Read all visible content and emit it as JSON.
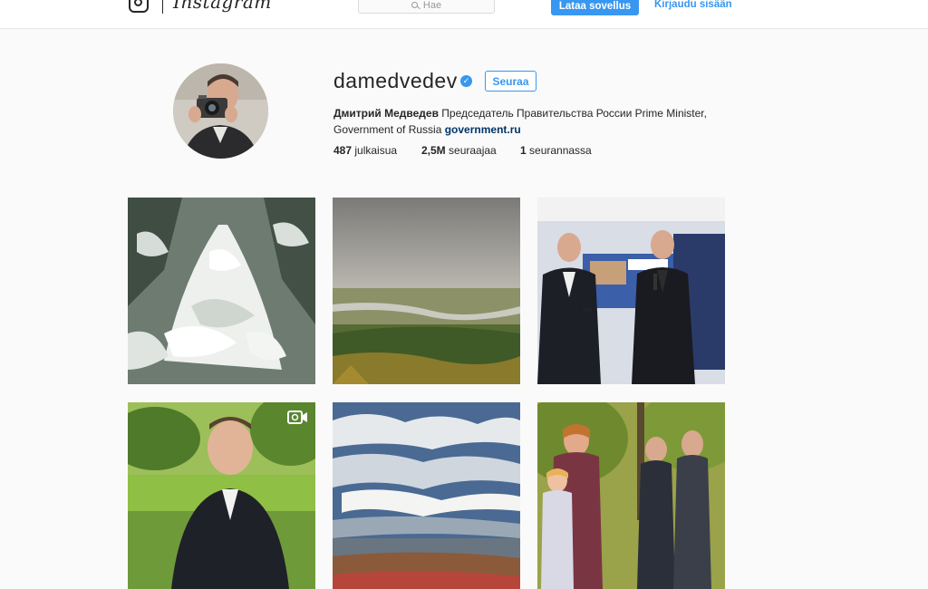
{
  "nav": {
    "wordmark": "Instagram",
    "search_placeholder": "Hae",
    "download_label": "Lataa sovellus",
    "login_label": "Kirjaudu sisään"
  },
  "profile": {
    "username": "damedvedev",
    "follow_label": "Seuraa",
    "full_name": "Дмитрий Медведев",
    "bio_text": " Председатель Правительства России Prime Minister, Government of Russia ",
    "website": "government.ru",
    "stats": {
      "posts_count": "487",
      "posts_label": " julkaisua",
      "followers_count": "2,5M",
      "followers_label": " seuraajaa",
      "following_count": "1",
      "following_label": " seurannassa"
    }
  },
  "posts": [
    {
      "subject": "snow-covered fir branches"
    },
    {
      "subject": "aerial autumn river valley"
    },
    {
      "subject": "two men speaking at event"
    },
    {
      "subject": "man in garden",
      "is_video": true
    },
    {
      "subject": "painted cloudy sky"
    },
    {
      "subject": "people in autumn park"
    }
  ],
  "colors": {
    "accent": "#3897f0",
    "link": "#003569",
    "background": "#fafafa",
    "text": "#262626"
  }
}
